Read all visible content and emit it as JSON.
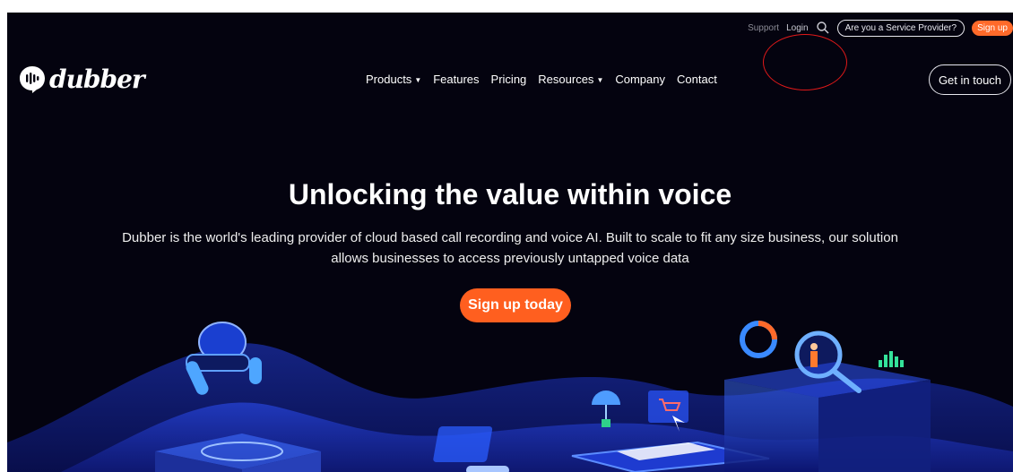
{
  "utility_bar": {
    "support_label": "Support",
    "login_label": "Login",
    "provider_button_label": "Are you a Service Provider?",
    "signup_label": "Sign up"
  },
  "header": {
    "logo_text": "dubber",
    "nav": [
      {
        "label": "Products",
        "dropdown": true
      },
      {
        "label": "Features",
        "dropdown": false
      },
      {
        "label": "Pricing",
        "dropdown": false
      },
      {
        "label": "Resources",
        "dropdown": true
      },
      {
        "label": "Company",
        "dropdown": false
      },
      {
        "label": "Contact",
        "dropdown": false
      }
    ],
    "cta_label": "Get in touch"
  },
  "hero": {
    "title": "Unlocking the value within voice",
    "description": "Dubber is the world's leading provider of cloud based call recording and voice AI. Built to scale to fit any size business, our solution allows businesses to access previously untapped voice data",
    "cta_label": "Sign up today"
  },
  "colors": {
    "background": "#04030f",
    "accent": "#ff5f1f",
    "annotation": "#e01919"
  }
}
